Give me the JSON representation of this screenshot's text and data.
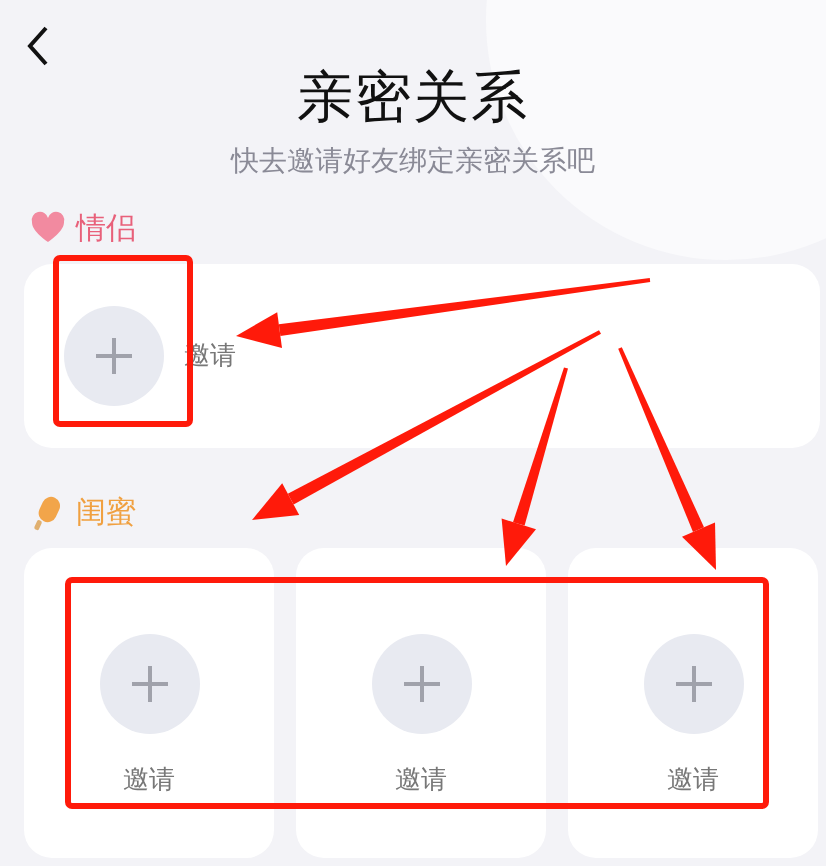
{
  "header": {
    "title": "亲密关系",
    "subtitle": "快去邀请好友绑定亲密关系吧"
  },
  "sections": [
    {
      "kind": "couple",
      "label": "情侣",
      "slots": [
        {
          "label": "邀请"
        }
      ]
    },
    {
      "kind": "bestie",
      "label": "闺蜜",
      "slots": [
        {
          "label": "邀请"
        },
        {
          "label": "邀请"
        },
        {
          "label": "邀请"
        }
      ]
    }
  ]
}
